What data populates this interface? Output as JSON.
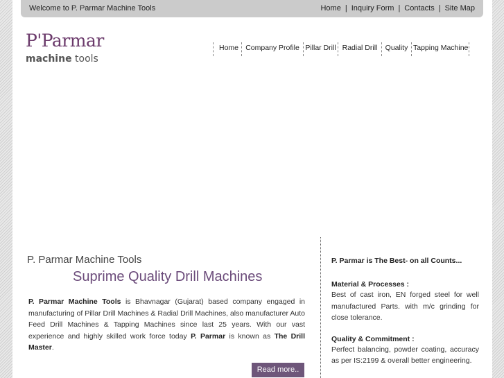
{
  "topbar": {
    "welcome": "Welcome to P. Parmar Machine Tools",
    "links": [
      "Home",
      "Inquiry Form",
      "Contacts",
      "Site Map"
    ],
    "separator": "|"
  },
  "logo": {
    "brand": "P'Parmar",
    "line2_bold": "machine",
    "line2_rest": " tools",
    "color": "#6b3a6b"
  },
  "nav": [
    "Home",
    "Company Profile",
    "Pillar Drill",
    "Radial Drill",
    "Quality",
    "Tapping Machine"
  ],
  "intro": {
    "title": "P. Parmar Machine Tools",
    "subtitle": "Suprime Quality Drill Machines",
    "company_bold": "P. Parmar Machine Tools",
    "text1": " is Bhavnagar (Gujarat) based company engaged in manufacturing of Pillar Drill Machines & Radial Drill Machines, also manufacturer Auto Feed Drill Machines & Tapping Machines since last 25 years. With our vast experience and highly skilled work force today ",
    "brand_bold": "P. Parmar",
    "text2": " is known as ",
    "drill_master": "The Drill Master",
    "text3": ".",
    "readmore": "Read more..",
    "accent": "#6e567a"
  },
  "side": {
    "heading": "P. Parmar is The Best- on all Counts...",
    "blocks": [
      {
        "title": "Material & Processes :",
        "text": "Best of cast iron, EN forged steel for well manufactured Parts. with m/c grinding for close tolerance."
      },
      {
        "title": "Quality & Commitment :",
        "text": "Perfect balancing, powder coating, accuracy as per IS:2199 & overall better engineering."
      }
    ]
  }
}
